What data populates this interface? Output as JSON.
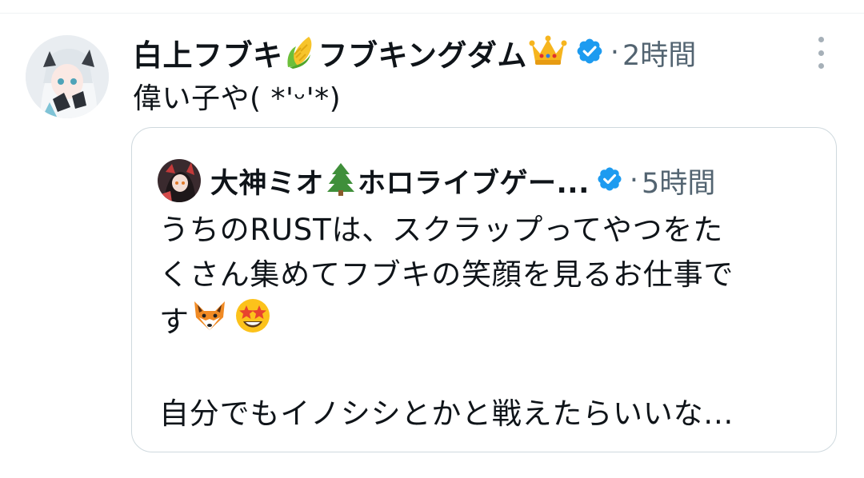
{
  "tweet": {
    "author_name": "白上フブキ",
    "author_name_suffix": "フブキングダム",
    "separator": "·",
    "time": "2時間",
    "text": "偉い子や( *'ᵕ'*)"
  },
  "quote": {
    "author_name": "大神ミオ",
    "author_name_suffix": "ホロライブゲー...",
    "separator": "·",
    "time": "5時間",
    "line1": "うちのRUSTは、スクラップってやつをた",
    "line2": "くさん集めてフブキの笑顔を見るお仕事で",
    "line3": "す",
    "line4": "自分でもイノシシとかと戦えたらいいな..."
  },
  "icons": {
    "corn": "corn-emoji",
    "crown": "crown-emoji",
    "tree": "evergreen-tree-emoji",
    "fox": "fox-emoji",
    "star_eyes": "star-struck-emoji",
    "verified": "verified-badge-icon",
    "more": "more-options-icon"
  },
  "colors": {
    "verified_blue": "#1d9bf0",
    "secondary_text": "#536471",
    "border": "#cfd9de"
  }
}
